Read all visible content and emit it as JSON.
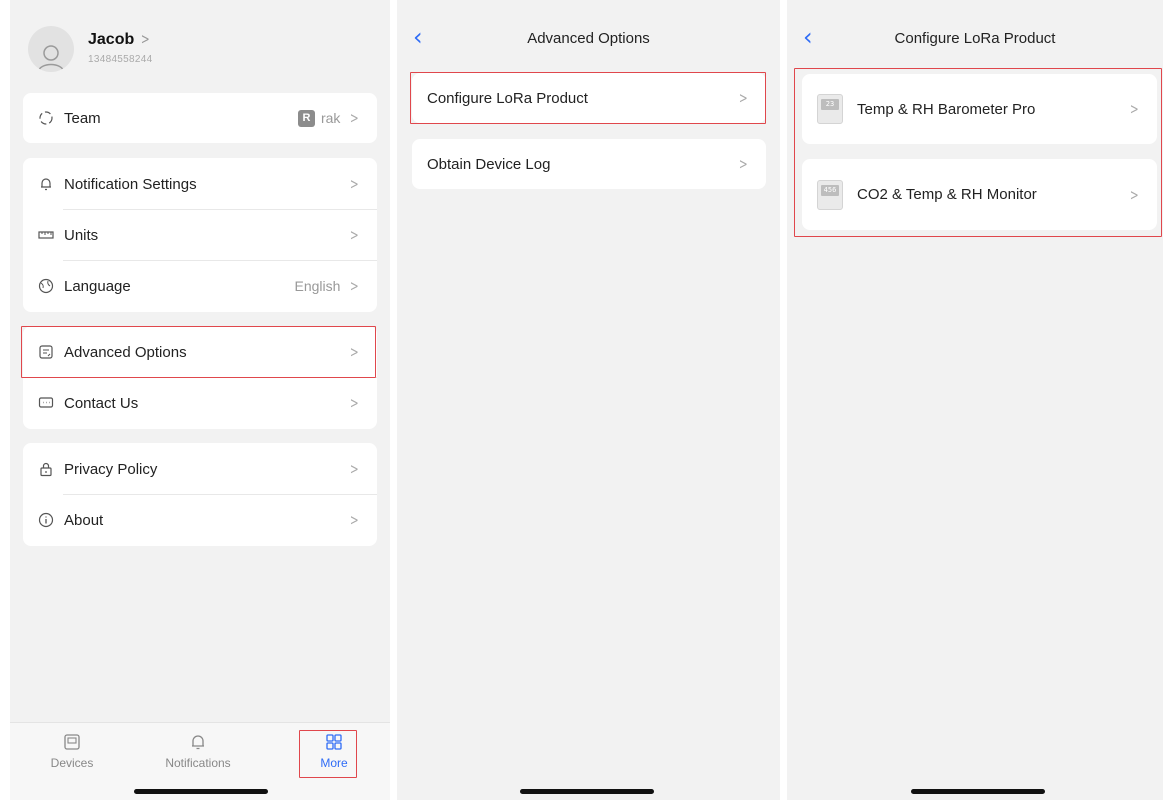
{
  "profile": {
    "name": "Jacob",
    "name_chevron": ">",
    "phone": "13484558244"
  },
  "more": {
    "team": {
      "label": "Team",
      "badge": "R",
      "value": "rak"
    },
    "settings": [
      {
        "label": "Notification Settings",
        "icon": "bell-settings-icon"
      },
      {
        "label": "Units",
        "icon": "ruler-icon"
      },
      {
        "label": "Language",
        "value": "English",
        "icon": "globe-icon"
      }
    ],
    "support": [
      {
        "label": "Advanced Options",
        "icon": "advanced-icon"
      },
      {
        "label": "Contact Us",
        "icon": "chat-icon"
      }
    ],
    "legal": [
      {
        "label": "Privacy Policy",
        "icon": "lock-icon"
      },
      {
        "label": "About",
        "icon": "info-icon"
      }
    ]
  },
  "tabbar": {
    "tabs": [
      {
        "label": "Devices",
        "icon": "devices-icon"
      },
      {
        "label": "Notifications",
        "icon": "bell-icon"
      },
      {
        "label": "More",
        "icon": "grid-icon",
        "active": true
      }
    ]
  },
  "advanced": {
    "title": "Advanced Options",
    "items": [
      {
        "label": "Configure LoRa Product"
      },
      {
        "label": "Obtain Device Log"
      }
    ]
  },
  "configure": {
    "title": "Configure LoRa Product",
    "products": [
      {
        "label": "Temp & RH Barometer Pro",
        "screen": "23"
      },
      {
        "label": "CO2 & Temp & RH Monitor",
        "screen": "456"
      }
    ]
  },
  "chevron": ">",
  "colors": {
    "accent": "#2f6cf6",
    "highlight": "#e0474c",
    "background": "#f2f2f2"
  }
}
